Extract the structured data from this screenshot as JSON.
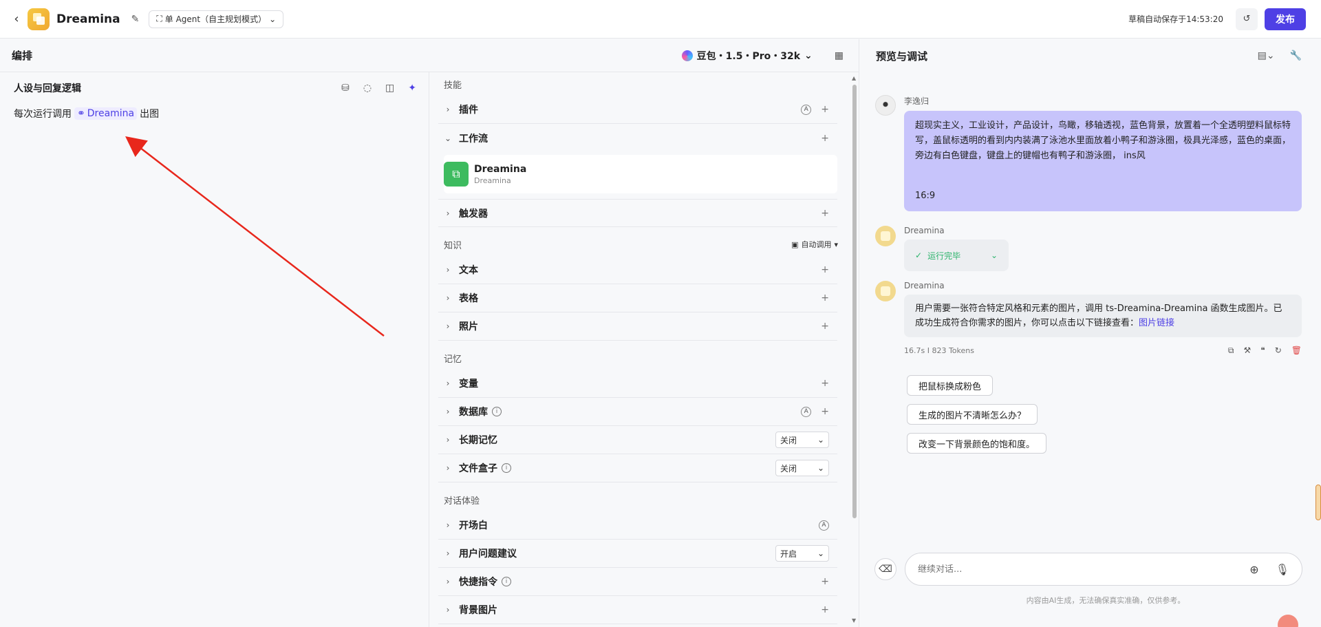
{
  "topbar": {
    "app_title": "Dreamina",
    "agent_mode": "单 Agent（自主规划模式）",
    "autosave": "草稿自动保存于14:53:20",
    "publish": "发布"
  },
  "left": {
    "title": "编排",
    "model": "豆包・1.5・Pro・32k"
  },
  "persona": {
    "title": "人设与回复逻辑",
    "text_prefix": "每次运行调用",
    "workflow_tag": "Dreamina",
    "text_suffix": "出图"
  },
  "skills": {
    "section": "技能",
    "plugins": "插件",
    "workflow": "工作流",
    "workflow_card_name": "Dreamina",
    "workflow_card_sub": "Dreamina",
    "triggers": "触发器"
  },
  "knowledge": {
    "section": "知识",
    "auto_call": "自动调用",
    "text": "文本",
    "table": "表格",
    "photo": "照片"
  },
  "memory": {
    "section": "记忆",
    "variables": "变量",
    "database": "数据库",
    "long_term": "长期记忆",
    "long_term_value": "关闭",
    "file_box": "文件盒子",
    "file_box_value": "关闭"
  },
  "dialog": {
    "section": "对话体验",
    "opening": "开场白",
    "suggestions": "用户问题建议",
    "suggestions_value": "开启",
    "shortcuts": "快捷指令",
    "background": "背景图片"
  },
  "preview": {
    "title": "预览与调试",
    "user_name": "李逸归",
    "user_msg": "超现实主义，工业设计，产品设计，鸟瞰，移轴透视，蓝色背景，放置着一个全透明塑料鼠标特写，盖鼠标透明的看到内内装满了泳池水里面放着小鸭子和游泳圈，极具光泽感，蓝色的桌面，旁边有白色键盘，键盘上的键帽也有鸭子和游泳圈， ins风",
    "user_ratio": "16:9",
    "bot_name": "Dreamina",
    "run_status": "运行完毕",
    "bot_name2": "Dreamina",
    "bot_msg": "用户需要一张符合特定风格和元素的图片，调用 ts-Dreamina-Dreamina 函数生成图片。已成功生成符合你需求的图片，你可以点击以下链接查看：",
    "bot_link": "图片链接",
    "meta": "16.7s  I  823 Tokens",
    "suggestions": [
      "把鼠标换成粉色",
      "生成的图片不清晰怎么办？",
      "改变一下背景颜色的饱和度。"
    ],
    "input_placeholder": "继续对话...",
    "disclaimer": "内容由AI生成，无法确保真实准确，仅供参考。"
  },
  "colors": {
    "accent": "#4e40e5",
    "user_bubble": "#c7c4fb",
    "success": "#2bb36b",
    "arrow": "#e8271c"
  }
}
